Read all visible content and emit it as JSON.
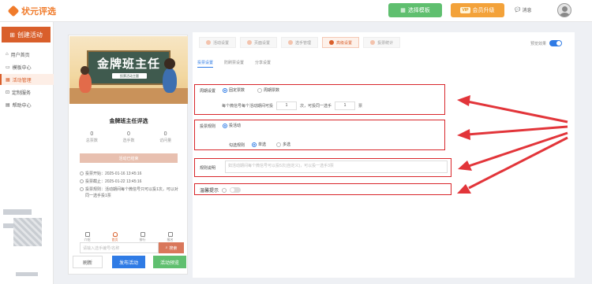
{
  "header": {
    "brand": "状元评选",
    "template_button": "选择模板",
    "vip_badge": "VIP",
    "vip_button": "会员升级",
    "message_label": "消息"
  },
  "sidebar": {
    "create_button": "创建活动",
    "items": [
      {
        "label": "用户首页",
        "icon": "home-icon"
      },
      {
        "label": "模板中心",
        "icon": "folder-icon"
      },
      {
        "label": "活动管理",
        "icon": "grid-icon",
        "active": true
      },
      {
        "label": "定制服务",
        "icon": "cart-icon"
      },
      {
        "label": "帮助中心",
        "icon": "book-icon"
      }
    ]
  },
  "preview": {
    "banner_title": "金牌班主任",
    "banner_subtitle": "投票活动主题",
    "activity_title": "金牌班主任评选",
    "stats": [
      {
        "value": "0",
        "label": "总票数"
      },
      {
        "value": "0",
        "label": "选手数"
      },
      {
        "value": "0",
        "label": "访问量"
      }
    ],
    "status_button": "活动已结束",
    "info": [
      "投票开始：2025-01-16 13:45:16",
      "投票截止：2025-01-22 13:45:16",
      "投票规则：活动期间每个微信号只可以投1次，可以对同一选手投1票"
    ],
    "search_placeholder": "请输入选手编号/名称",
    "search_button": "搜索",
    "tabs": [
      {
        "label": "介绍",
        "active": false
      },
      {
        "label": "首页",
        "active": true
      },
      {
        "label": "排行",
        "active": false
      },
      {
        "label": "报名",
        "active": false
      }
    ]
  },
  "actions": {
    "refresh": "刷新",
    "publish": "发布活动",
    "preview": "活动预览"
  },
  "steps": [
    {
      "label": "活动设置",
      "active": false
    },
    {
      "label": "页面设置",
      "active": false
    },
    {
      "label": "选手管理",
      "active": false
    },
    {
      "label": "高级设置",
      "active": true
    },
    {
      "label": "投票统计",
      "active": false
    }
  ],
  "live_preview": {
    "label": "预览效果",
    "enabled": true
  },
  "subtabs": [
    {
      "label": "投票设置",
      "active": true
    },
    {
      "label": "防刷票设置",
      "active": false
    },
    {
      "label": "分享设置",
      "active": false
    }
  ],
  "form": {
    "cycle": {
      "label": "周期设置",
      "options": [
        "固定票数",
        "周期票数"
      ],
      "selected": "固定票数",
      "text1": "每个微信号每个活动期间可投",
      "votes": "1",
      "text2": "次，可投同一选手",
      "per_candidate": "1",
      "text3": "票"
    },
    "rule": {
      "label": "投票规则",
      "options": [
        "投活动"
      ],
      "selected": "投活动",
      "multi_label": "勾选规则",
      "multi_options": [
        "单选",
        "多选"
      ],
      "multi_selected": "单选"
    },
    "description": {
      "label": "规则说明",
      "placeholder": "如活动期间每个微信号可以投5次(自定义)，可以投一选手3票"
    },
    "tip": {
      "label": "温馨提示",
      "enabled": false
    }
  },
  "colors": {
    "brand": "#f07b2b",
    "accent": "#d95f2b",
    "primary": "#2f7be5",
    "success": "#5fbf6f",
    "highlight_box": "#d8262b"
  }
}
